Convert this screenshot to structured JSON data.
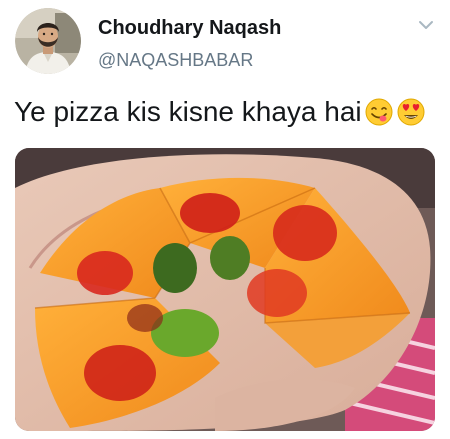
{
  "tweet": {
    "author": {
      "display_name": "Choudhary Naqash",
      "username": "@NAQASHBABAR",
      "avatar_icon": "profile-photo"
    },
    "menu_icon": "chevron-down-icon",
    "text": "Ye pizza kis kisne khaya hai",
    "emojis": [
      "face-savoring-food-emoji",
      "smiling-face-with-heart-eyes-emoji"
    ],
    "media": {
      "kind": "photo",
      "subject": "pizza-shaped gummy candy held in a hand"
    },
    "colors": {
      "name": "#14171a",
      "username": "#657786",
      "chevron": "#aab8c2",
      "background": "#ffffff"
    }
  }
}
